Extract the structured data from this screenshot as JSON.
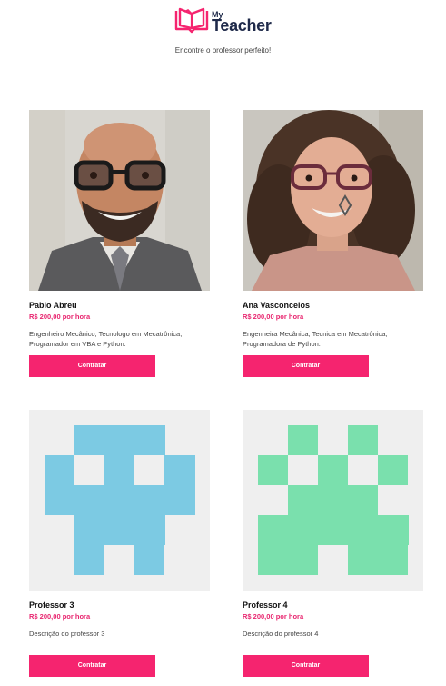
{
  "brand": {
    "my": "My",
    "teacher": "Teacher",
    "primary_color": "#f5246f",
    "dark_color": "#1f2a4a"
  },
  "header": {
    "tagline": "Encontre o professor perfeito!"
  },
  "teachers": [
    {
      "name": "Pablo Abreu",
      "price": "R$ 200,00 por hora",
      "description": "Engenheiro Mecânico, Tecnologo em Mecatrônica, Programador em VBA e Python.",
      "button_label": "Contratar"
    },
    {
      "name": "Ana Vasconcelos",
      "price": "R$ 200,00 por hora",
      "description": "Engenheira Mecânica, Tecnica em Mecatrônica, Programadora de Python.",
      "button_label": "Contratar"
    },
    {
      "name": "Professor 3",
      "price": "R$ 200,00 por hora",
      "description": "Descrição do professor 3",
      "button_label": "Contratar",
      "avatar_color": "#7ccae3"
    },
    {
      "name": "Professor 4",
      "price": "R$ 200,00 por hora",
      "description": "Descrição do professor 4",
      "button_label": "Contratar",
      "avatar_color": "#7ae0ad"
    }
  ]
}
